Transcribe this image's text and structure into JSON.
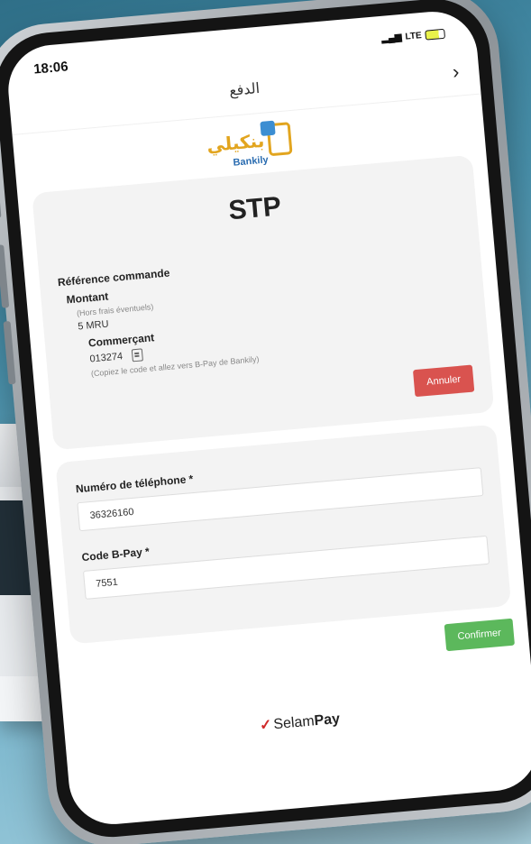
{
  "status_bar": {
    "time": "18:06",
    "network": "LTE"
  },
  "header": {
    "title": "الدفع",
    "back_icon": "›"
  },
  "logo": {
    "arabic_text": "بنكيلي",
    "name": "Bankily"
  },
  "merchant": {
    "title": "STP",
    "order_ref_label": "Référence commande",
    "amount_label": "Montant",
    "amount_note": "(Hors frais éventuels)",
    "amount_value": "5 MRU",
    "merchant_label": "Commerçant",
    "merchant_code": "013274",
    "copy_hint": "(Copiez le code et allez vers B-Pay de Bankily)",
    "cancel_label": "Annuler"
  },
  "form": {
    "phone_label": "Numéro de téléphone *",
    "phone_value": "36326160",
    "code_label": "Code B-Pay *",
    "code_value": "7551",
    "confirm_label": "Confirmer"
  },
  "footer": {
    "brand_prefix": "Selam",
    "brand_suffix": "Pay"
  }
}
